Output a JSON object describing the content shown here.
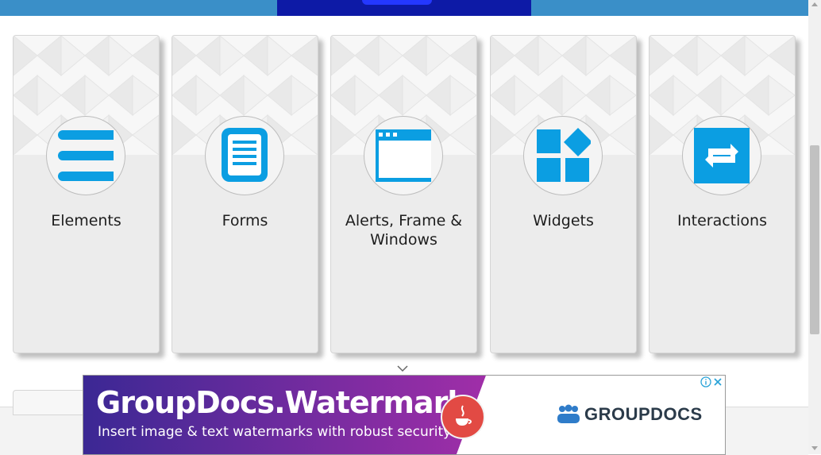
{
  "cards": [
    {
      "title": "Elements",
      "icon": "list-icon"
    },
    {
      "title": "Forms",
      "icon": "document-icon"
    },
    {
      "title": "Alerts, Frame & Windows",
      "icon": "browser-window-icon"
    },
    {
      "title": "Widgets",
      "icon": "widgets-icon"
    },
    {
      "title": "Interactions",
      "icon": "interactions-icon"
    }
  ],
  "colors": {
    "accent": "#0b9ee2",
    "top_bar": "#3a8fc8",
    "banner": "#0d1aa6",
    "card_bg": "#ececec",
    "ad_gradient_start": "#3b2894",
    "ad_gradient_end": "#a02ea8"
  },
  "ad": {
    "headline": "GroupDocs.Watermark",
    "subline": "Insert image & text watermarks with robust security",
    "brand": "GROUPDOCS"
  }
}
